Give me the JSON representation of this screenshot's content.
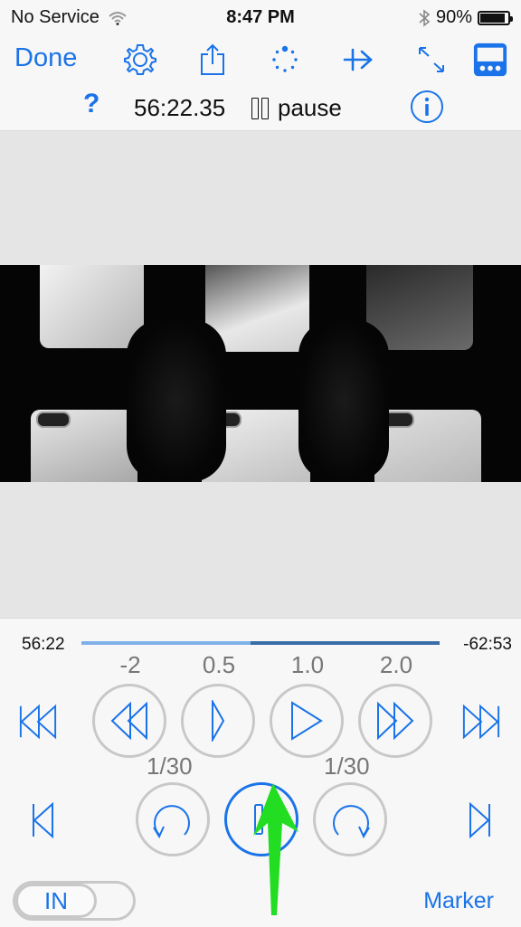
{
  "status_bar": {
    "carrier": "No Service",
    "time": "8:47 PM",
    "battery_percent": "90%",
    "battery_level": 0.9
  },
  "toolbar": {
    "done_label": "Done",
    "icons": [
      "gear-icon",
      "share-icon",
      "loop-dots-icon",
      "jump-forward-icon",
      "fullscreen-icon",
      "controls-panel-icon"
    ]
  },
  "subbar": {
    "help_label": "?",
    "timecode": "56:22.35",
    "state_label": "pause"
  },
  "scrubber": {
    "elapsed": "56:22",
    "remaining": "-62:53",
    "progress": 0.473
  },
  "speed_controls": [
    {
      "label": "-2",
      "icon": "rewind-icon"
    },
    {
      "label": "0.5",
      "icon": "slow-play-icon"
    },
    {
      "label": "1.0",
      "icon": "play-icon"
    },
    {
      "label": "2.0",
      "icon": "fast-forward-icon"
    }
  ],
  "frame_step": {
    "back_label": "1/30",
    "forward_label": "1/30"
  },
  "in_toggle_label": "IN",
  "marker_label": "Marker",
  "colors": {
    "accent": "#1a73e8",
    "arrow": "#22dd22",
    "circle_border": "#c8c8c8"
  }
}
